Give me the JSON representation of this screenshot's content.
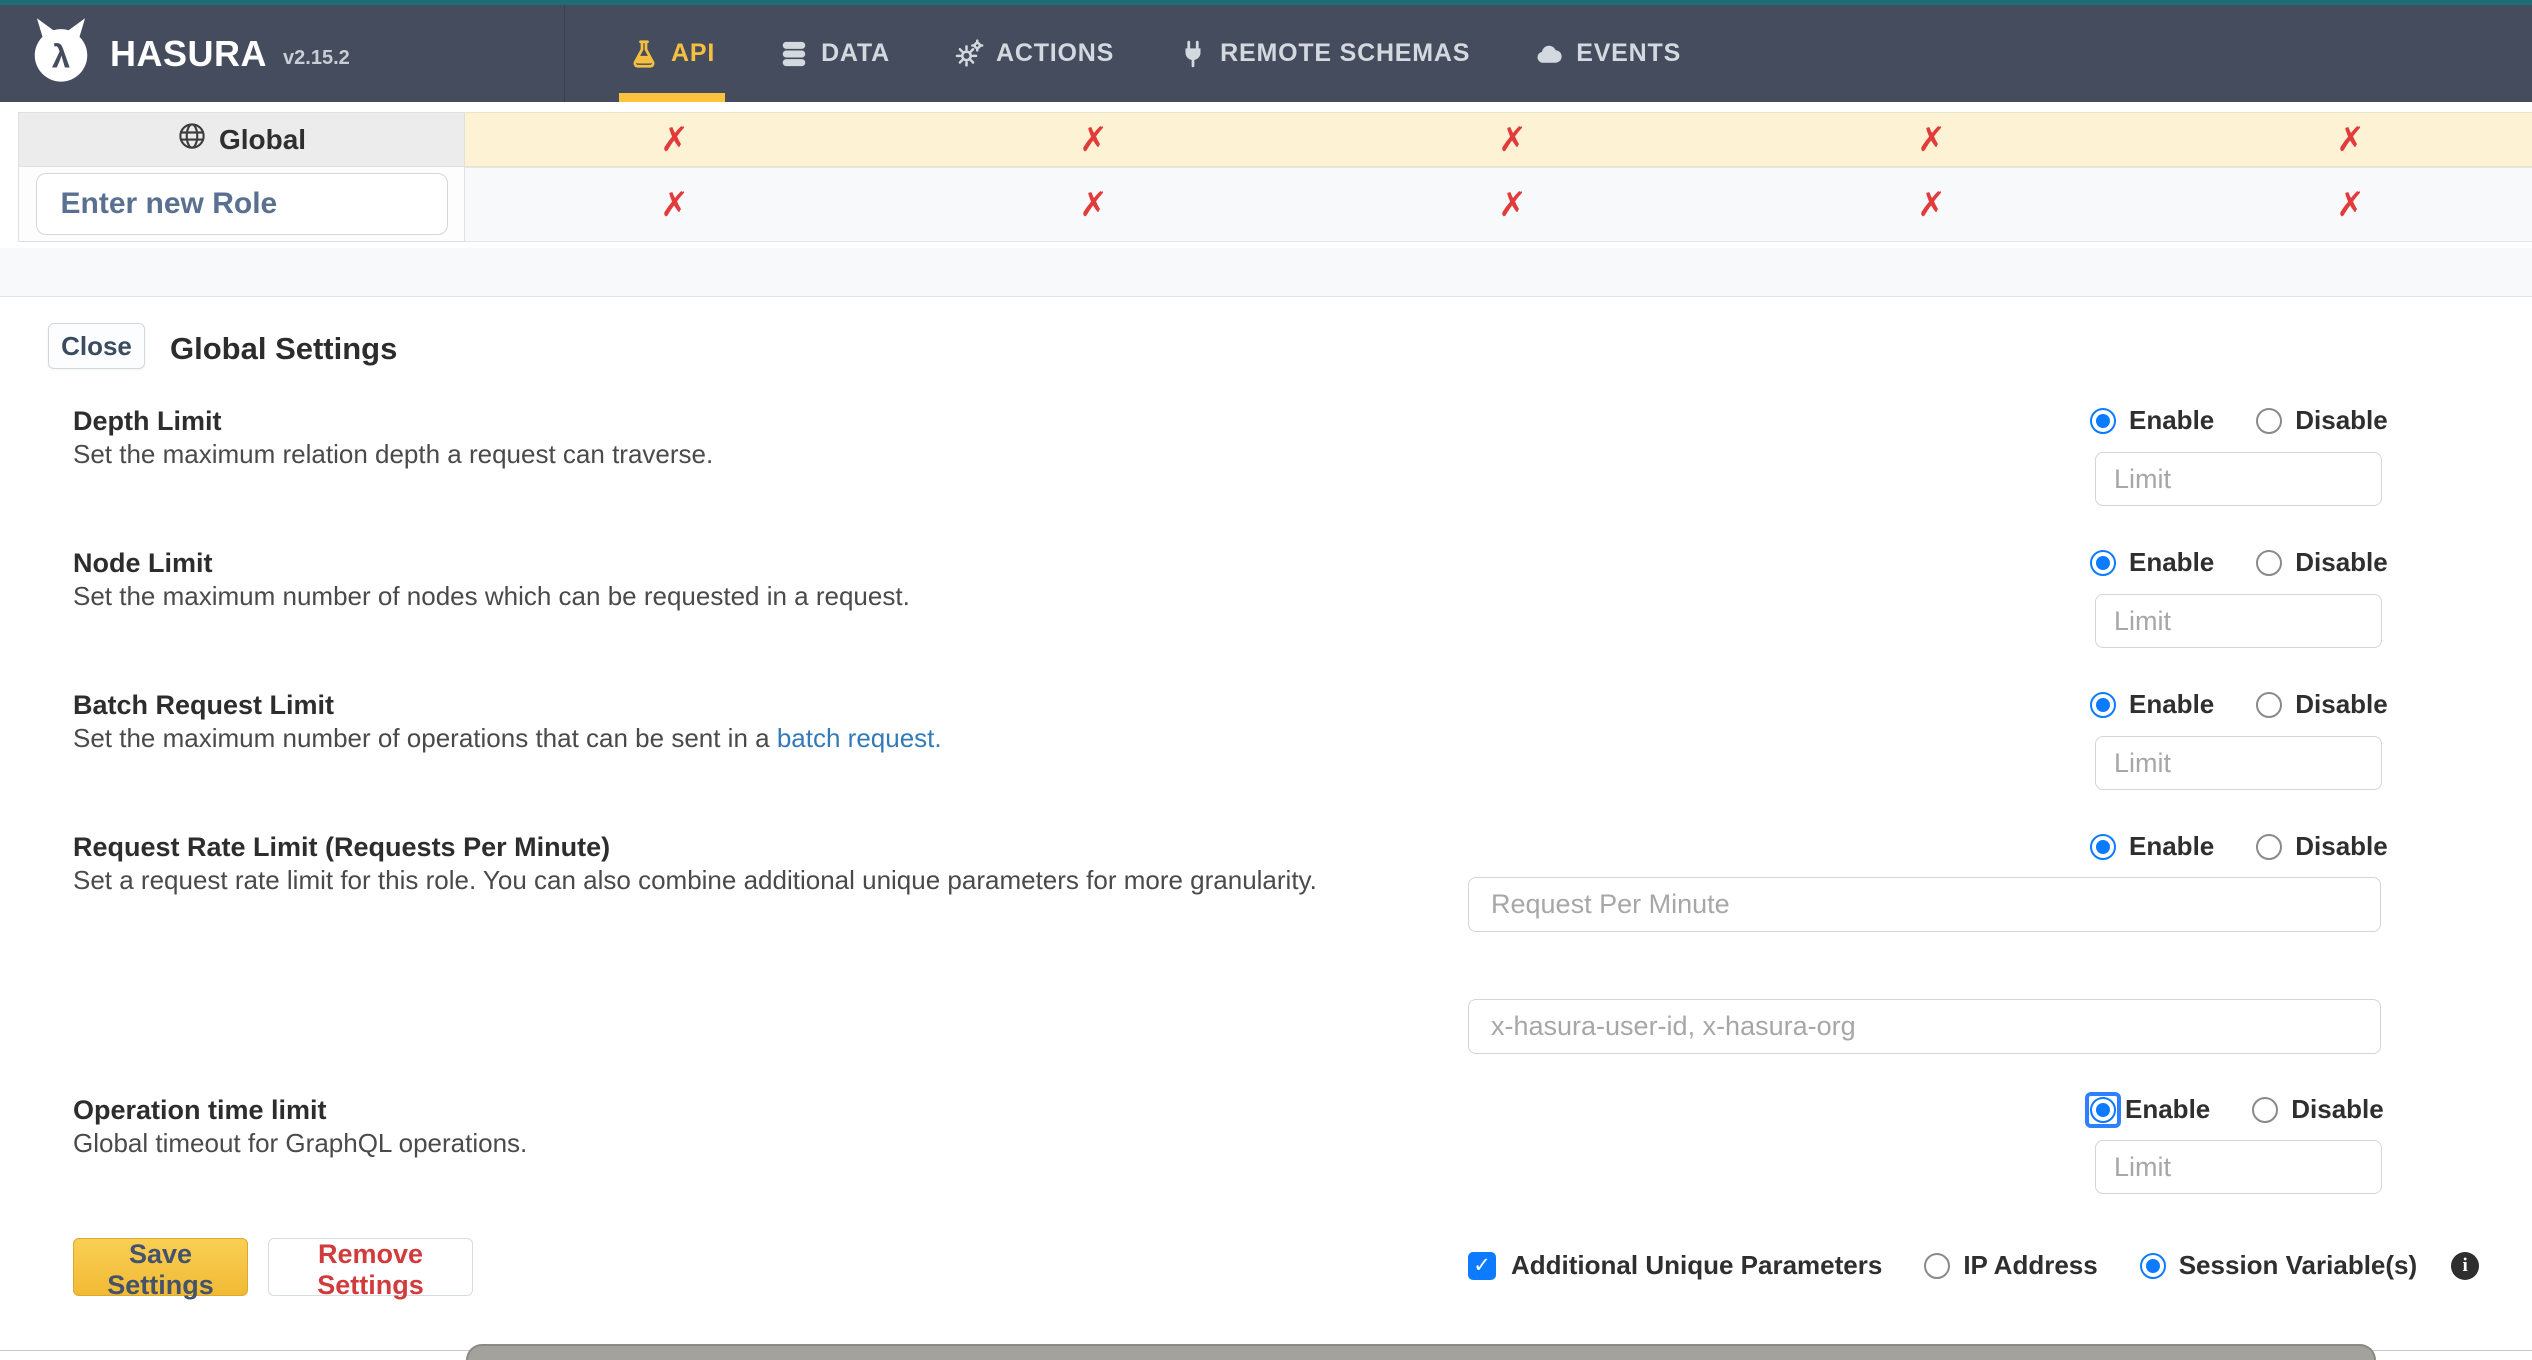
{
  "header": {
    "brand": "HASURA",
    "version": "v2.15.2",
    "nav": [
      {
        "label": "API",
        "icon": "flask-icon",
        "active": true
      },
      {
        "label": "DATA",
        "icon": "database-icon",
        "active": false
      },
      {
        "label": "ACTIONS",
        "icon": "gears-icon",
        "active": false
      },
      {
        "label": "REMOTE SCHEMAS",
        "icon": "plug-icon",
        "active": false
      },
      {
        "label": "EVENTS",
        "icon": "cloud-icon",
        "active": false
      }
    ]
  },
  "roles_table": {
    "global_label": "Global",
    "new_role_placeholder": "Enter new Role",
    "cross_symbol": "✗",
    "permission_columns": 5
  },
  "panel": {
    "close_label": "Close",
    "title": "Global Settings",
    "labels": {
      "enable": "Enable",
      "disable": "Disable",
      "limit_placeholder": "Limit"
    },
    "sections": [
      {
        "title": "Depth Limit",
        "description": "Set the maximum relation depth a request can traverse.",
        "state": "enabled"
      },
      {
        "title": "Node Limit",
        "description": "Set the maximum number of nodes which can be requested in a request.",
        "state": "enabled"
      },
      {
        "title": "Batch Request Limit",
        "description_prefix": "Set the maximum number of operations that can be sent in a ",
        "link_text": "batch request.",
        "state": "enabled"
      },
      {
        "title": "Request Rate Limit (Requests Per Minute)",
        "description": "Set a request rate limit for this role. You can also combine additional unique parameters for more granularity.",
        "rpm_placeholder": "Request Per Minute",
        "checkbox_label": "Additional Unique Parameters",
        "checkbox_checked": true,
        "ip_label": "IP Address",
        "session_label": "Session Variable(s)",
        "session_selected": true,
        "unique_params_placeholder": "x-hasura-user-id, x-hasura-org",
        "info_glyph": "i",
        "state": "enabled"
      },
      {
        "title": "Operation time limit",
        "description": "Global timeout for GraphQL operations.",
        "state": "enabled-focused"
      }
    ],
    "save_label": "Save Settings",
    "remove_label": "Remove Settings"
  },
  "colors": {
    "header_bg": "#454c5e",
    "teal_strip": "#1d6d75",
    "active_nav_yellow": "#f5c03f",
    "underline_yellow": "#fec33d",
    "cell_yellow": "#fdf2d3",
    "cross_red": "#e23b3b",
    "radio_blue": "#0d7bff",
    "link_blue": "#337ab7",
    "save_button_yellow": "#f5c144",
    "remove_text_red": "#d23b3b"
  }
}
